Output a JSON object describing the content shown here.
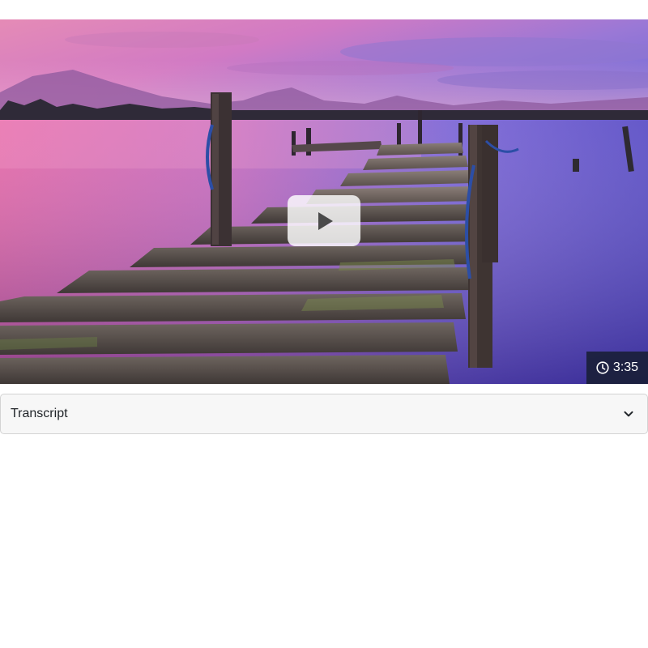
{
  "video": {
    "thumbnail_subject": "sunset-lake-pier",
    "play_icon": "play-icon",
    "duration": "3:35",
    "duration_icon": "clock-icon"
  },
  "transcript": {
    "label": "Transcript",
    "toggle_icon": "chevron-down-icon"
  },
  "colors": {
    "badge_background": "#1a203a",
    "badge_text": "#ffffff",
    "play_button_background": "#ffffff",
    "play_icon": "#4a4a4a",
    "transcript_background": "#f7f7f7",
    "transcript_border": "#d3d3d3",
    "transcript_text": "#212529"
  }
}
